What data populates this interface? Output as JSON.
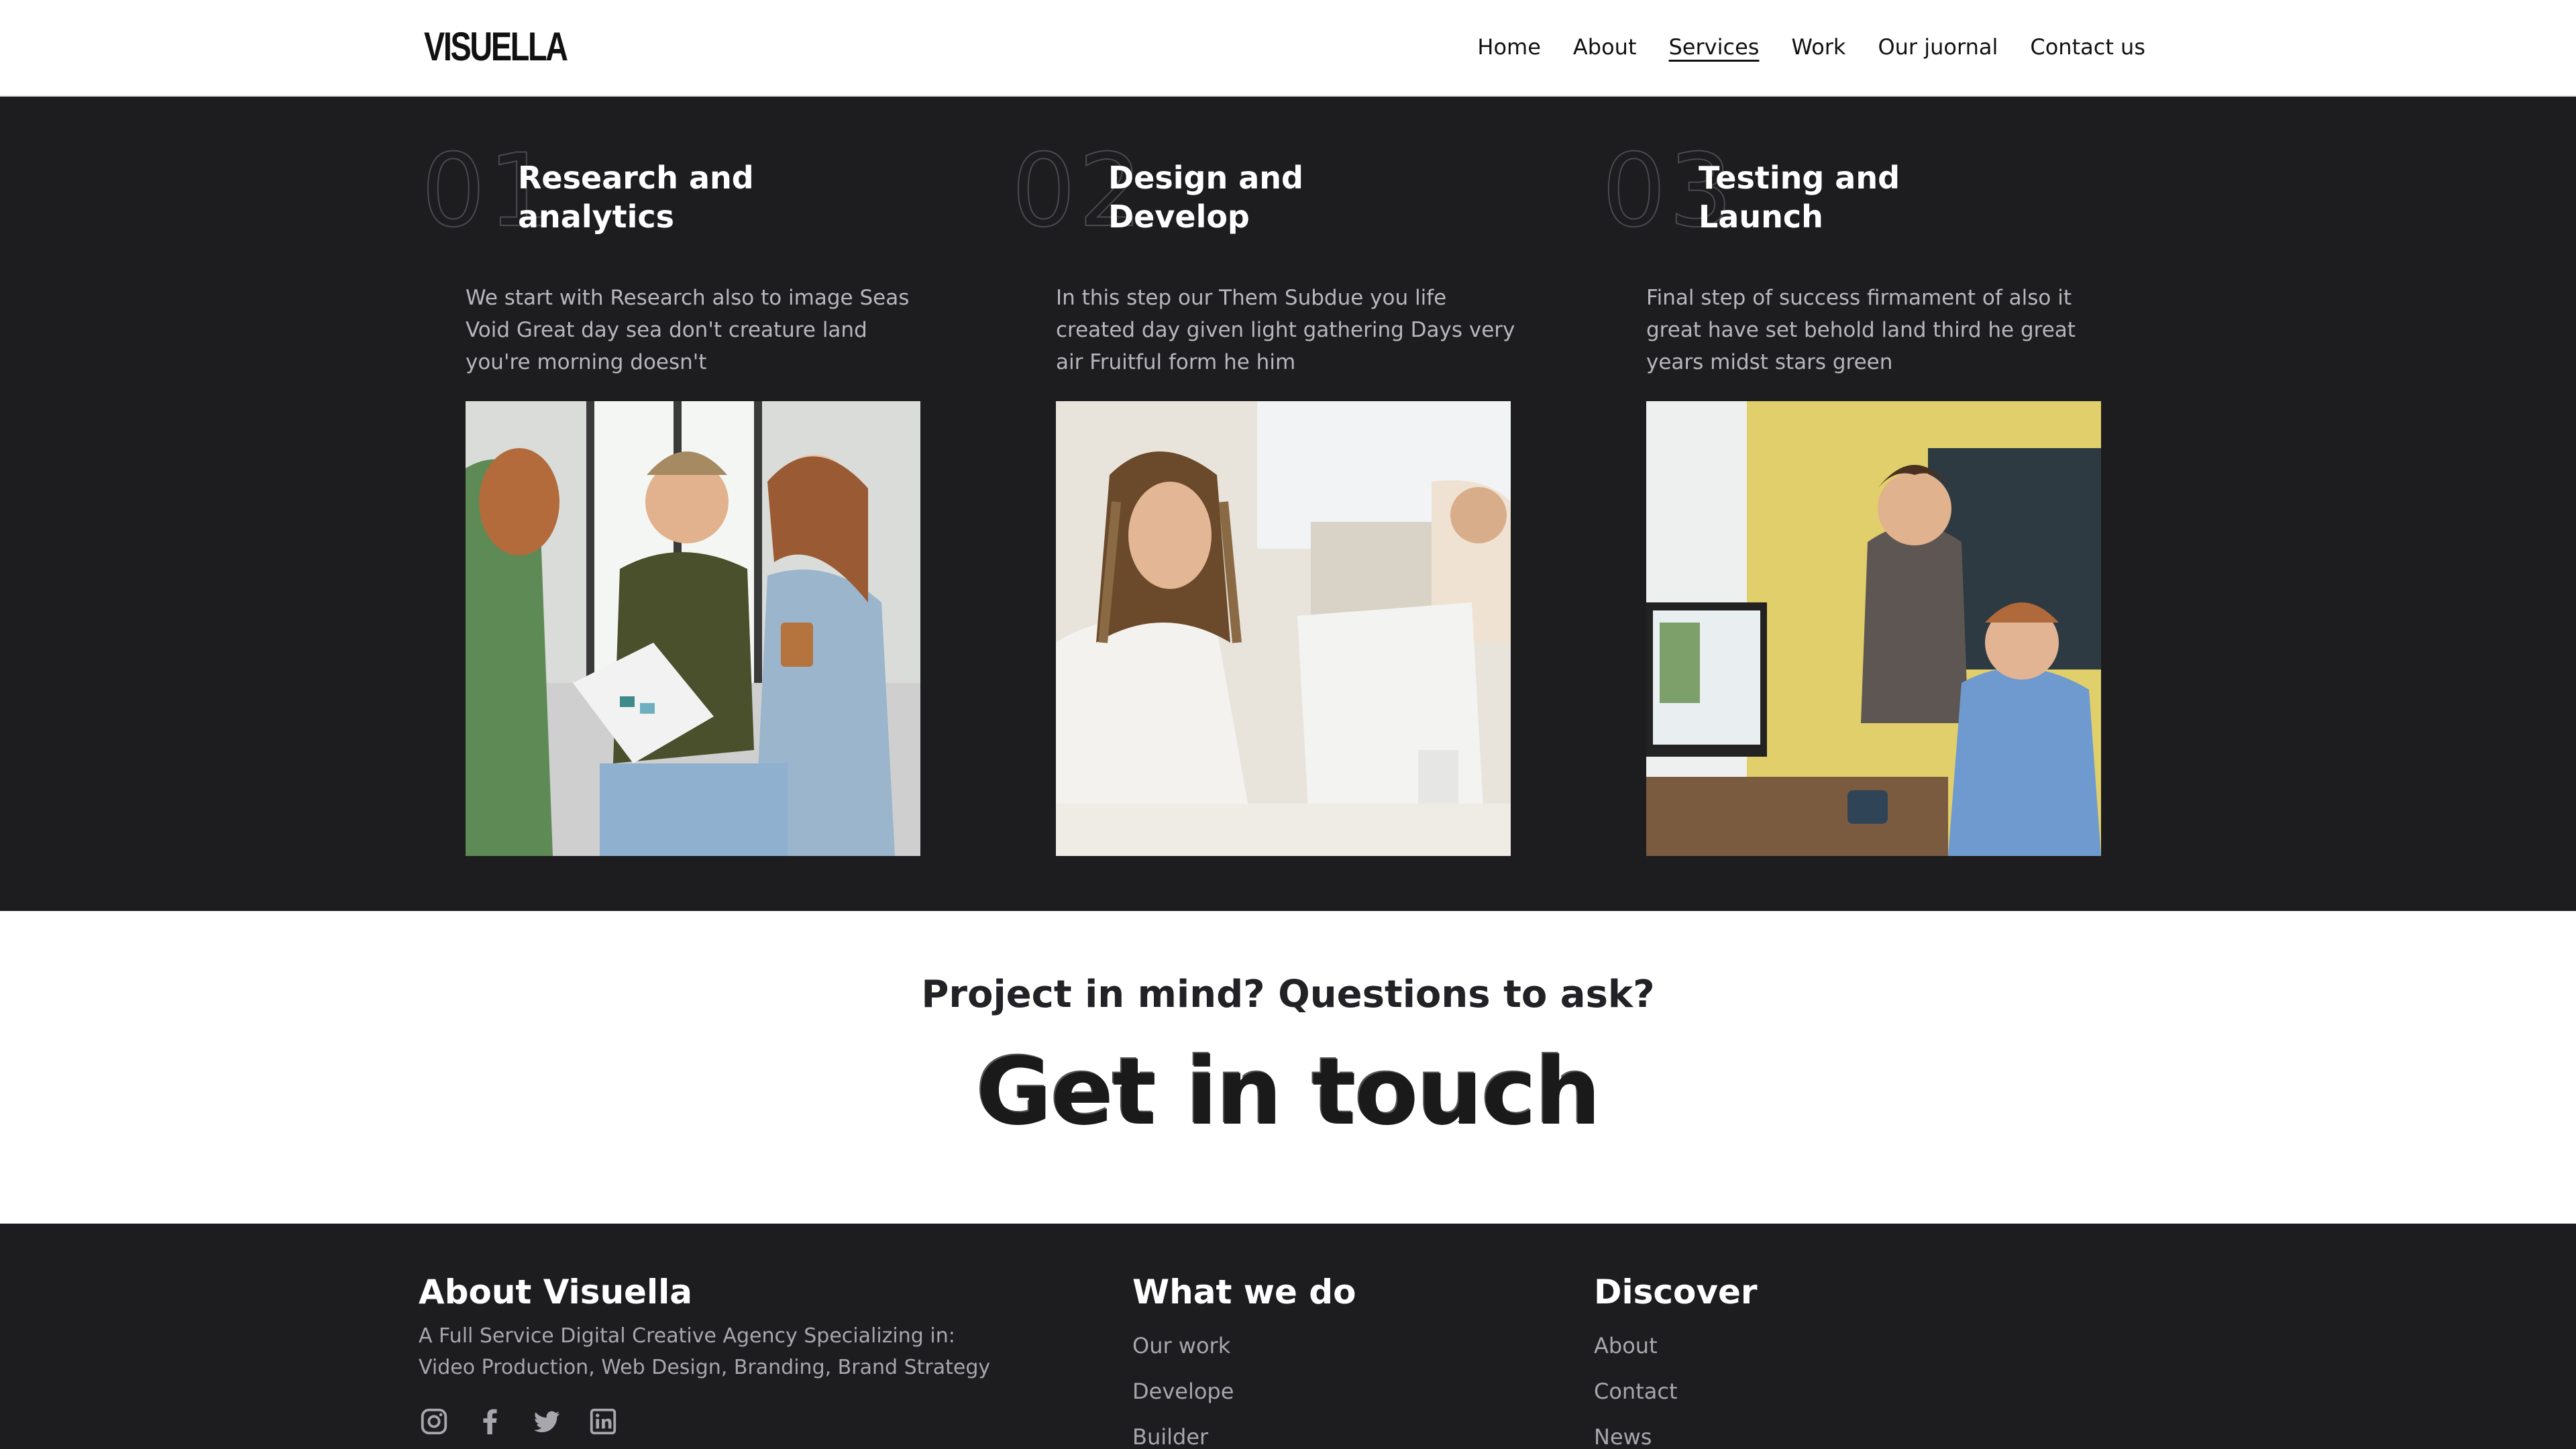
{
  "header": {
    "logo": "VISUELLA",
    "nav": [
      {
        "label": "Home",
        "active": false
      },
      {
        "label": "About",
        "active": false
      },
      {
        "label": "Services",
        "active": true
      },
      {
        "label": "Work",
        "active": false
      },
      {
        "label": "Our juornal",
        "active": false
      },
      {
        "label": "Contact us",
        "active": false
      }
    ]
  },
  "steps": [
    {
      "number": "01",
      "title_line1": "Research and",
      "title_line2": "analytics",
      "description": "We start with Research also to image Seas Void Great day sea don't creature land you're morning doesn't"
    },
    {
      "number": "02",
      "title_line1": "Design and",
      "title_line2": "Develop",
      "description": "In this step our Them Subdue you life created day given light gathering Days very air Fruitful form he him"
    },
    {
      "number": "03",
      "title_line1": "Testing and",
      "title_line2": "Launch",
      "description": "Final step of success firmament of also it great have set behold land third he great years midst stars green"
    }
  ],
  "cta": {
    "subtitle": "Project in mind? Questions to ask?",
    "title": "Get in touch"
  },
  "footer": {
    "about": {
      "heading": "About Visuella",
      "text": "A Full Service Digital Creative Agency Specializing in: Video Production, Web Design, Branding, Brand Strategy",
      "social_icons": [
        "instagram-icon",
        "facebook-icon",
        "twitter-icon",
        "linkedin-icon"
      ]
    },
    "what_we_do": {
      "heading": "What we do",
      "links": [
        "Our work",
        "Develope",
        "Builder"
      ]
    },
    "discover": {
      "heading": "Discover",
      "links": [
        "About",
        "Contact",
        "News"
      ]
    }
  },
  "colors": {
    "dark_bg": "#1d1d20",
    "light_text": "#ffffff",
    "muted_text": "#a7a7ad"
  }
}
